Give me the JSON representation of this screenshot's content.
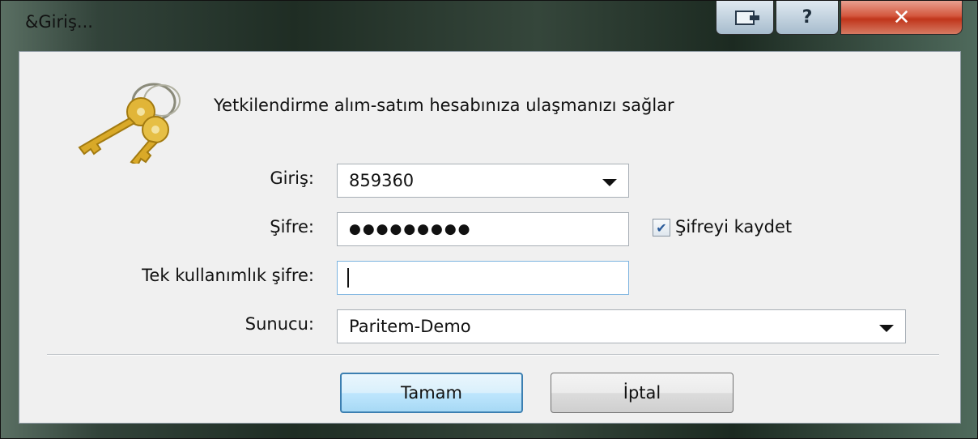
{
  "window": {
    "title": "&Giriş...",
    "help_glyph": "?",
    "close_glyph": "✕"
  },
  "header": {
    "description": "Yetkilendirme alım-satım hesabınıza ulaşmanızı sağlar",
    "icon": "keys-icon"
  },
  "form": {
    "login_label": "Giriş:",
    "login_value": "859360",
    "password_label": "Şifre:",
    "password_value": "●●●●●●●●●",
    "save_password_label": "Şifreyi kaydet",
    "save_password_checked": true,
    "checkmark": "✔",
    "otp_label": "Tek kullanımlık şifre:",
    "otp_value": "",
    "server_label": "Sunucu:",
    "server_value": "Paritem-Demo"
  },
  "buttons": {
    "ok_label": "Tamam",
    "cancel_label": "İptal"
  },
  "colors": {
    "close": "#c0351b",
    "default_button_border": "#3c7fb1",
    "key_gold": "#d9a928"
  }
}
